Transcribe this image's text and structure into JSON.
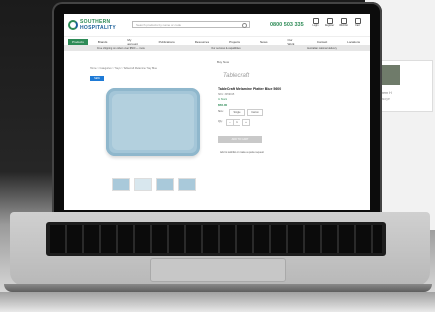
{
  "background": {
    "side_text_1": "Southern H",
    "side_text_2": "Ivanosoye"
  },
  "header": {
    "brand_top": "SOUTHERN",
    "brand_bottom": "HOSPITALITY",
    "search_placeholder": "Search products by name or code",
    "phone": "0800 503 335",
    "actions": [
      "Login",
      "Register",
      "Wishlist",
      "Cart"
    ]
  },
  "nav": {
    "items": [
      "Products",
      "Brands",
      "My account",
      "Publications",
      "Resources",
      "Projects",
      "News",
      "Our Work",
      "Contact",
      "Locations"
    ]
  },
  "info_bar": {
    "items": [
      "Free shipping on orders over $500 — more",
      "Our services & capabilities",
      "Australian national delivery"
    ]
  },
  "breadcrumb": "Home > Categories > Trays > Tablecraft Melamine Tray Blue",
  "badge": "NEW",
  "product": {
    "section": "Buy Now",
    "brand": "Tablecraft",
    "title": "TableCraft Melamine Platter Blue 5600",
    "sku": "SKU: 3459015",
    "stock": "In Stock",
    "price": "$56.00",
    "pack_label": "Size:",
    "options": [
      "Single",
      "Carton"
    ],
    "qty_label": "Qty:",
    "qty_value": "1",
    "cart_button": "ADD TO CART",
    "wishlist": "Add to wishlist or make a quote request"
  },
  "colors": {
    "brand_green": "#2e8b57",
    "brand_blue": "#1a5f99",
    "badge_blue": "#1e7ad6",
    "tray_blue": "#a4c6d8"
  },
  "icons": [
    "search-icon",
    "user-icon",
    "register-icon",
    "heart-icon",
    "cart-icon",
    "logo-mark-icon"
  ]
}
